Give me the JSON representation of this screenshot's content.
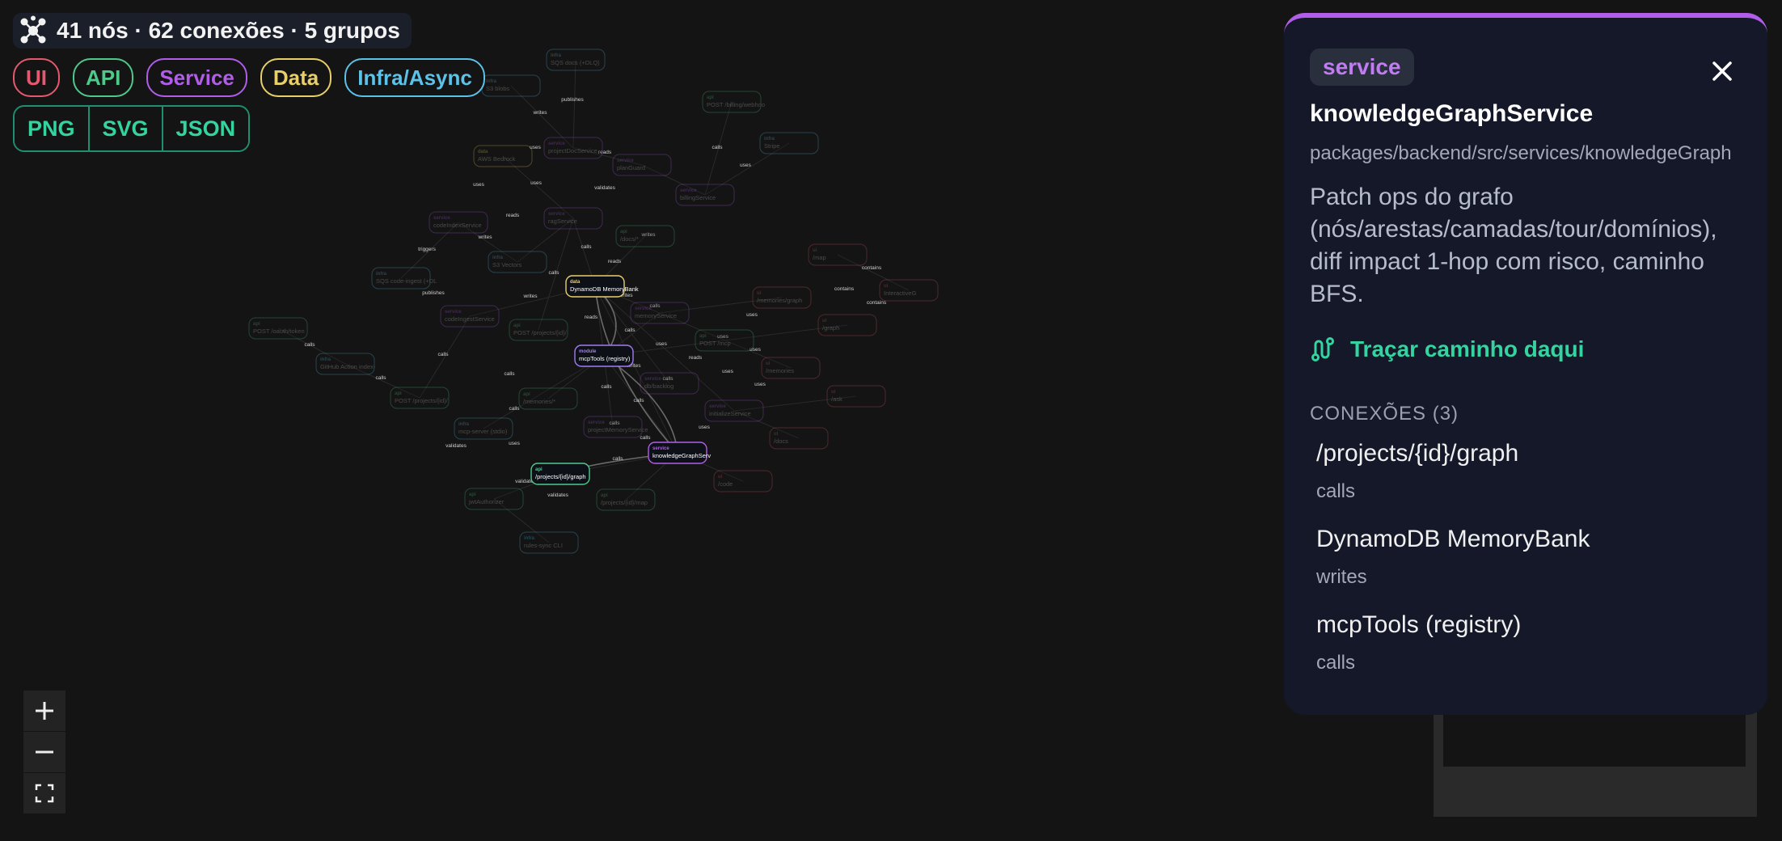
{
  "summary": {
    "icon": "graph-icon",
    "text": "41 nós · 62 conexões · 5 grupos"
  },
  "filters": [
    {
      "label": "UI",
      "color": "#e5586d"
    },
    {
      "label": "API",
      "color": "#4ec98a"
    },
    {
      "label": "Service",
      "color": "#b05ee8"
    },
    {
      "label": "Data",
      "color": "#e8cf6a"
    },
    {
      "label": "Infra/Async",
      "color": "#5cc2e8"
    }
  ],
  "exports": [
    "PNG",
    "SVG",
    "JSON"
  ],
  "zoom": {
    "in_icon": "plus-icon",
    "out_icon": "minus-icon",
    "fit_icon": "fit-view-icon"
  },
  "panel": {
    "type_badge": "service",
    "name": "knowledgeGraphService",
    "path": "packages/backend/src/services/knowledgeGraph",
    "description": "Patch ops do grafo (nós/arestas/camadas/tour/domínios), diff impact 1-hop com risco, caminho BFS.",
    "trace_label": "Traçar caminho daqui",
    "trace_icon": "route-icon",
    "close_icon": "close-icon",
    "connections_header": "CONEXÕES (3)",
    "connections": [
      {
        "name": "/projects/{id}/graph",
        "rel": "calls"
      },
      {
        "name": "DynamoDB MemoryBank",
        "rel": "writes"
      },
      {
        "name": "mcpTools (registry)",
        "rel": "calls"
      }
    ]
  },
  "graph": {
    "nodes": [
      {
        "type": "infra",
        "label": "SQS docs (+DLQ)",
        "hl": false
      },
      {
        "type": "infra",
        "label": "S3 blobs",
        "hl": false
      },
      {
        "type": "api",
        "label": "POST /billing/webhook",
        "hl": false
      },
      {
        "type": "infra",
        "label": "Stripe",
        "hl": false
      },
      {
        "type": "data",
        "label": "AWS Bedrock",
        "hl": false
      },
      {
        "type": "service",
        "label": "projectDocService",
        "hl": false
      },
      {
        "type": "service",
        "label": "planGuard",
        "hl": false
      },
      {
        "type": "service",
        "label": "billingService",
        "hl": false
      },
      {
        "type": "service",
        "label": "codeIndexService",
        "hl": false
      },
      {
        "type": "service",
        "label": "ragService",
        "hl": false
      },
      {
        "type": "api",
        "label": "/docs/*",
        "hl": false
      },
      {
        "type": "ui",
        "label": "/map",
        "hl": false
      },
      {
        "type": "infra",
        "label": "S3 Vectors",
        "hl": false
      },
      {
        "type": "infra",
        "label": "SQS code-ingest (+DLQ)",
        "hl": false
      },
      {
        "type": "data",
        "label": "DynamoDB MemoryBank",
        "hl": true
      },
      {
        "type": "ui",
        "label": "InteractiveG",
        "hl": false
      },
      {
        "type": "ui",
        "label": "/memories/graph",
        "hl": false
      },
      {
        "type": "service",
        "label": "codeIngestService",
        "hl": false
      },
      {
        "type": "service",
        "label": "memoryService",
        "hl": false
      },
      {
        "type": "api",
        "label": "POST /oauth/token",
        "hl": false
      },
      {
        "type": "api",
        "label": "POST /projects/{id}/ask",
        "hl": false
      },
      {
        "type": "ui",
        "label": "/graph",
        "hl": false
      },
      {
        "type": "api",
        "label": "POST /mcp",
        "hl": false
      },
      {
        "type": "module",
        "label": "mcpTools (registry)",
        "hl": true
      },
      {
        "type": "infra",
        "label": "GitHub Action index-code",
        "hl": false
      },
      {
        "type": "ui",
        "label": "/memories",
        "hl": false
      },
      {
        "type": "service",
        "label": "db/backlog",
        "hl": false
      },
      {
        "type": "api",
        "label": "POST /projects/{id}/code/in",
        "hl": false
      },
      {
        "type": "api",
        "label": "/memories/*",
        "hl": false
      },
      {
        "type": "ui",
        "label": "/ask",
        "hl": false
      },
      {
        "type": "service",
        "label": "initializeService",
        "hl": false
      },
      {
        "type": "infra",
        "label": "mcp-server (stdio)",
        "hl": false
      },
      {
        "type": "service",
        "label": "projectMemoryService",
        "hl": false
      },
      {
        "type": "ui",
        "label": "/docs",
        "hl": false
      },
      {
        "type": "service",
        "label": "knowledgeGraphServ",
        "hl": true
      },
      {
        "type": "api",
        "label": "/projects/{id}/graph",
        "hl": true
      },
      {
        "type": "ui",
        "label": "/code",
        "hl": false
      },
      {
        "type": "api",
        "label": "jwtAuthorizer",
        "hl": false
      },
      {
        "type": "api",
        "label": "/projects/{id}/map",
        "hl": false
      },
      {
        "type": "infra",
        "label": "rules-sync CLI",
        "hl": false
      }
    ],
    "edge_labels": [
      "publishes",
      "writes",
      "uses",
      "calls",
      "reads",
      "triggers",
      "validates",
      "contains"
    ]
  }
}
